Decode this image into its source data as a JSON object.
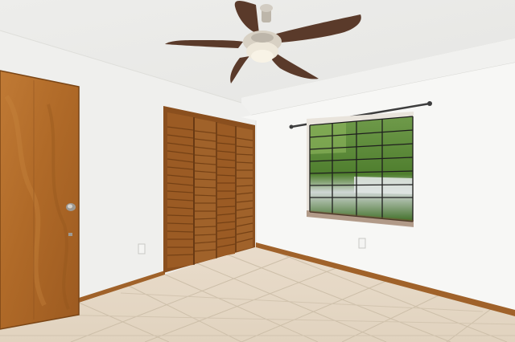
{
  "scene": {
    "subject": "empty-bedroom-interior",
    "colors": {
      "ceiling": "#efefed",
      "left_wall": "#ececea",
      "right_wall": "#f5f5f3",
      "floor_tile": "#e6d9c6",
      "grout": "#c8b9a4",
      "wood_door": "#b36f2e",
      "wood_dark": "#8a4f1e",
      "baseboard": "#a0622a",
      "window_frame": "#1e1e1e",
      "foliage": "#5f8f3c",
      "fan_blade": "#5a3a2a",
      "fan_metal": "#c9c2b6"
    },
    "icons": [
      "ceiling-fan-icon",
      "door-knob-icon",
      "curtain-rod-icon",
      "power-outlet-icon"
    ]
  }
}
